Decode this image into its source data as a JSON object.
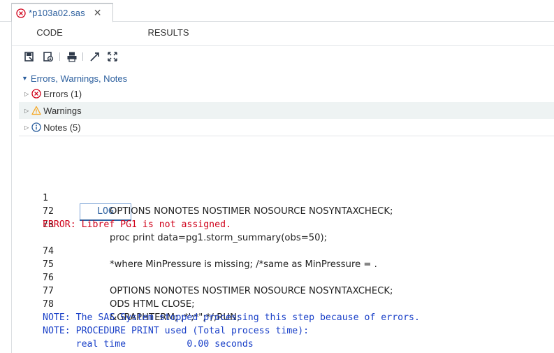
{
  "file_tab": {
    "name": "*p103a02.sas",
    "close": "✕"
  },
  "view_tabs": [
    {
      "label": "CODE"
    },
    {
      "label": "LOG"
    },
    {
      "label": "RESULTS"
    }
  ],
  "toolbar": {
    "buttons": [
      "save-log-icon",
      "download-log-icon",
      "print-icon",
      "new-window-icon",
      "maximize-icon"
    ]
  },
  "tree": {
    "header": "Errors, Warnings, Notes",
    "items": [
      {
        "label": "Errors (1)",
        "icon": "error-icon"
      },
      {
        "label": "Warnings",
        "icon": "warning-icon"
      },
      {
        "label": "Notes (5)",
        "icon": "info-icon"
      }
    ]
  },
  "log": {
    "lines": [
      {
        "num": "1",
        "code": "OPTIONS NONOTES NOSTIMER NOSOURCE NOSYNTAXCHECK;"
      },
      {
        "num": "72",
        "code": ""
      },
      {
        "num": "73",
        "code": "proc print data=pg1.storm_summary(obs=50);"
      },
      {
        "error": "ERROR: Libref PG1 is not assigned."
      },
      {
        "num": "74",
        "code": "*where MinPressure is missing; /*same as MinPressure = ."
      },
      {
        "num": "75",
        "code": ""
      },
      {
        "num": "76",
        "code": "OPTIONS NONOTES NOSTIMER NOSOURCE NOSYNTAXCHECK;"
      },
      {
        "num": "77",
        "code": "ODS HTML CLOSE;"
      },
      {
        "num": "78",
        "code": "&GRAPHTERM; ;*';*\";*/;RUN;"
      },
      {
        "note": "NOTE: The SAS System stopped processing this step because of errors."
      },
      {
        "note": "NOTE: PROCEDURE PRINT used (Total process time):"
      },
      {
        "note": "      real time           0.00 seconds"
      }
    ]
  },
  "colors": {
    "accent": "#2c5f9e",
    "error": "#d0021b",
    "note": "#1a40c8",
    "warning": "#f5a623",
    "highlight_row": "#eef3f3"
  }
}
